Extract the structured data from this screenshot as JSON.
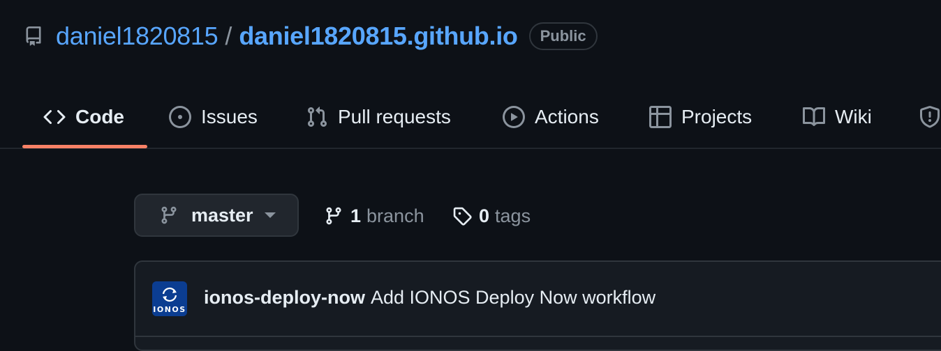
{
  "repo": {
    "owner": "daniel1820815",
    "separator": "/",
    "name": "daniel1820815.github.io",
    "visibility": "Public"
  },
  "tabs": [
    {
      "label": "Code",
      "icon": "code-icon",
      "active": true
    },
    {
      "label": "Issues",
      "icon": "issue-icon"
    },
    {
      "label": "Pull requests",
      "icon": "pull-request-icon"
    },
    {
      "label": "Actions",
      "icon": "play-icon"
    },
    {
      "label": "Projects",
      "icon": "table-icon"
    },
    {
      "label": "Wiki",
      "icon": "book-icon"
    },
    {
      "label": "",
      "icon": "shield-icon"
    }
  ],
  "branch": {
    "current": "master",
    "count": "1",
    "count_label": "branch",
    "tags_count": "0",
    "tags_label": "tags"
  },
  "latest_commit": {
    "author": "ionos-deploy-now",
    "message": "Add IONOS Deploy Now workflow",
    "avatar_text": "IONOS"
  },
  "colors": {
    "background": "#0d1117",
    "link": "#58a6ff",
    "active_tab_underline": "#f78166",
    "muted": "#8b949e",
    "avatar_bg": "#0b3d91"
  }
}
